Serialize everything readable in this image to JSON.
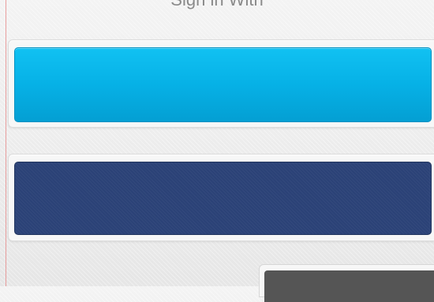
{
  "page": {
    "heading": "Sign in With"
  },
  "buttons": {
    "twitter": {
      "label": "",
      "color": "#06b1e6"
    },
    "facebook": {
      "label": "",
      "color": "#2b4277"
    },
    "bottom": {
      "label": "",
      "color": "#555555"
    }
  },
  "colors": {
    "background": "#ececec",
    "card": "#f7f7f7",
    "heading_text": "#8a8a8a"
  }
}
